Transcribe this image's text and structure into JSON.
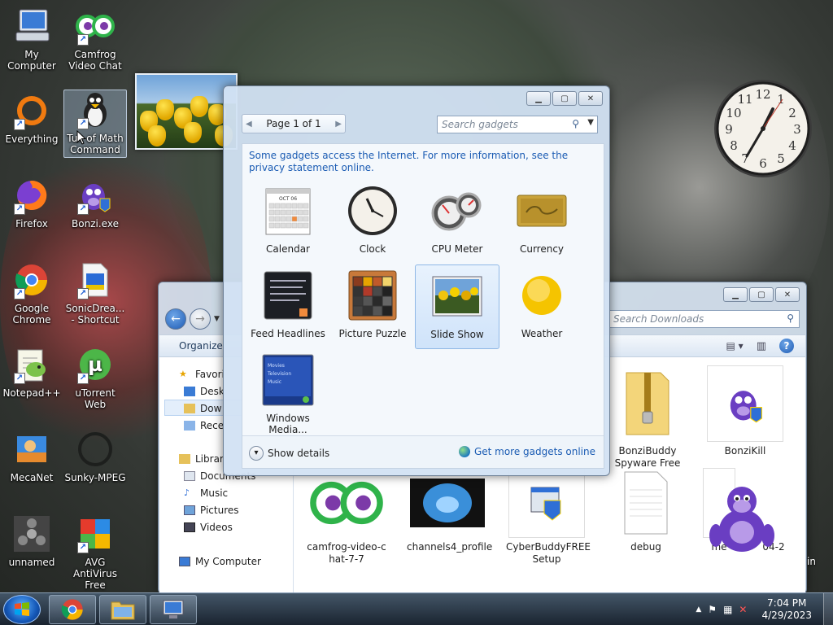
{
  "desktop": {
    "icons": [
      {
        "label": "My Computer",
        "icon": "computer-icon"
      },
      {
        "label": "Camfrog Video Chat",
        "icon": "camfrog-icon"
      },
      {
        "label": "Everything",
        "icon": "everything-icon"
      },
      {
        "label": "Tux of Math Command",
        "icon": "tux-icon"
      },
      {
        "label": "Firefox",
        "icon": "firefox-icon"
      },
      {
        "label": "Bonzi.exe",
        "icon": "bonzi-icon"
      },
      {
        "label": "Google Chrome",
        "icon": "chrome-icon"
      },
      {
        "label": "SonicDrea... - Shortcut",
        "icon": "sonic-icon"
      },
      {
        "label": "Notepad++",
        "icon": "notepadpp-icon"
      },
      {
        "label": "uTorrent Web",
        "icon": "utorrent-icon"
      },
      {
        "label": "MecaNet",
        "icon": "mecanet-icon"
      },
      {
        "label": "Sunky-MPEG",
        "icon": "sunky-icon"
      },
      {
        "label": "unnamed",
        "icon": "fidget-spinner-icon"
      },
      {
        "label": "AVG AntiVirus Free",
        "icon": "avg-icon"
      }
    ]
  },
  "gallery": {
    "page_label": "Page 1 of 1",
    "search_placeholder": "Search gadgets",
    "notice": "Some gadgets access the Internet.  For more information, see the privacy statement online.",
    "gadgets": [
      {
        "label": "Calendar",
        "icon": "calendar-icon"
      },
      {
        "label": "Clock",
        "icon": "clock-icon"
      },
      {
        "label": "CPU Meter",
        "icon": "cpu-meter-icon"
      },
      {
        "label": "Currency",
        "icon": "currency-icon"
      },
      {
        "label": "Feed Headlines",
        "icon": "feed-icon"
      },
      {
        "label": "Picture Puzzle",
        "icon": "puzzle-icon"
      },
      {
        "label": "Slide Show",
        "icon": "slideshow-icon"
      },
      {
        "label": "Weather",
        "icon": "weather-icon"
      },
      {
        "label": "Windows Media...",
        "icon": "media-center-icon"
      }
    ],
    "calendar_month": "OCT 06",
    "media_lines": [
      "Movies",
      "Television",
      "Music"
    ],
    "show_details": "Show details",
    "get_more": "Get more gadgets online"
  },
  "explorer": {
    "search_placeholder": "Search Downloads",
    "organize": "Organize",
    "sidebar": [
      "Favori",
      "Desk",
      "Dow",
      "Rece",
      "Librar",
      "Documents",
      "Music",
      "Pictures",
      "Videos",
      "My Computer"
    ],
    "files": [
      {
        "label": "BonziBuddy Spyware Free",
        "icon": "zip-folder-icon"
      },
      {
        "label": "BonziKill",
        "icon": "bonzi-icon"
      },
      {
        "label": "camfrog-video-chat-7-7",
        "icon": "camfrog-icon"
      },
      {
        "label": "channels4_profile",
        "icon": "image-icon"
      },
      {
        "label": "CyberBuddyFREE Setup",
        "icon": "installer-icon"
      },
      {
        "label": "debug",
        "icon": "text-file-icon"
      },
      {
        "label": "me",
        "icon": "file-icon"
      },
      {
        "label": "04-2",
        "icon": "file-icon"
      },
      {
        "label": "in",
        "icon": "file-icon"
      }
    ]
  },
  "taskbar": {
    "time": "7:04 PM",
    "date": "4/29/2023",
    "buttons": [
      "chrome-icon",
      "explorer-icon",
      "remote-desktop-icon"
    ]
  },
  "colors": {
    "accent": "#1a5bb3",
    "selection": "#cfe3fa"
  }
}
